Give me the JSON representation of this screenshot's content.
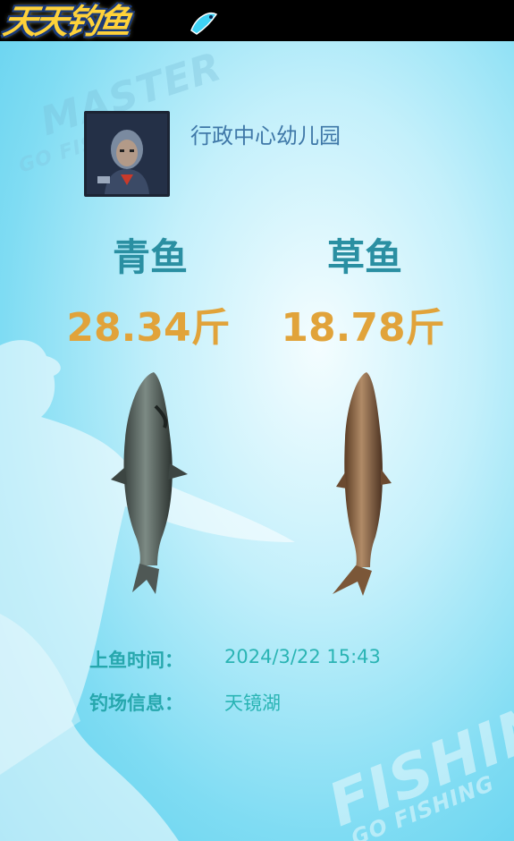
{
  "header": {
    "logo_text": "天天钓鱼"
  },
  "watermarks": {
    "top_main": "MASTER",
    "top_sub": "GO FISHING",
    "bottom_main": "FISHING",
    "bottom_sub": "GO FISHING"
  },
  "player": {
    "venue_name": "行政中心幼儿园"
  },
  "catches": [
    {
      "name": "青鱼",
      "weight": "28.34斤"
    },
    {
      "name": "草鱼",
      "weight": "18.78斤"
    }
  ],
  "info": {
    "time_label": "上鱼时间：",
    "time_value": "2024/3/22  15:43",
    "place_label": "钓场信息：",
    "place_value": "天镜湖"
  },
  "colors": {
    "fish_name": "#2a8fa2",
    "weight": "#e1a33a",
    "info_label": "#26a7ad",
    "venue": "#3f78a8"
  }
}
